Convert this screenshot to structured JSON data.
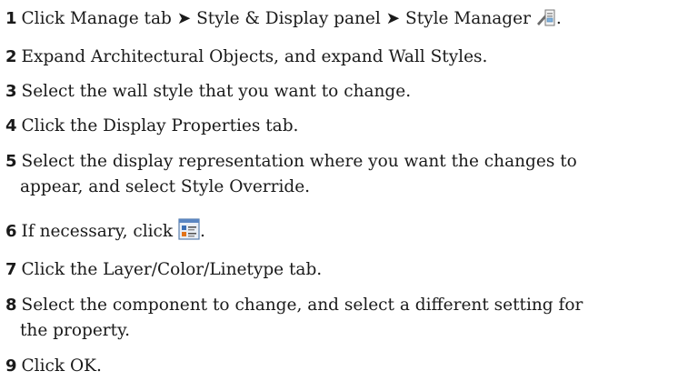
{
  "steps": [
    {
      "num": "1",
      "text_a": "Click Manage tab ➤ Style & Display panel ➤ Style Manager",
      "text_b": ".",
      "icon": "style-manager-icon"
    },
    {
      "num": "2",
      "text": "Expand Architectural Objects, and expand Wall Styles."
    },
    {
      "num": "3",
      "text": "Select the wall style that you want to change."
    },
    {
      "num": "4",
      "text": "Click the Display Properties tab."
    },
    {
      "num": "5",
      "text": "Select the display representation where you want the changes to",
      "cont": "appear, and select Style Override."
    },
    {
      "num": "6",
      "text_a": "If necessary, click",
      "text_b": ".",
      "icon": "edit-display-properties-icon"
    },
    {
      "num": "7",
      "text": "Click the Layer/Color/Linetype tab."
    },
    {
      "num": "8",
      "text": "Select the component to change, and select a different setting for",
      "cont": "the property."
    },
    {
      "num": "9",
      "text": "Click OK."
    }
  ]
}
